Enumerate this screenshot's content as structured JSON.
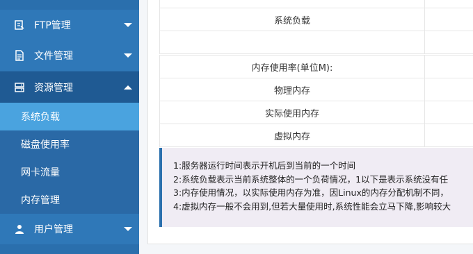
{
  "sidebar": {
    "menus": [
      {
        "label": "FTP管理",
        "icon": "ftp-icon"
      },
      {
        "label": "文件管理",
        "icon": "file-icon"
      },
      {
        "label": "资源管理",
        "icon": "server-icon"
      }
    ],
    "submenu": [
      {
        "label": "系统负载"
      },
      {
        "label": "磁盘使用率"
      },
      {
        "label": "网卡流量"
      },
      {
        "label": "内存管理"
      }
    ],
    "user_menu": {
      "label": "用户管理",
      "icon": "user-icon"
    }
  },
  "main": {
    "rows_top": [
      {
        "label": ""
      },
      {
        "label": "系统负载"
      },
      {
        "label": ""
      }
    ],
    "memory_header": "内存使用率(单位M):",
    "memory_rows": [
      {
        "label": "物理内存"
      },
      {
        "label": "实际使用内存"
      },
      {
        "label": "虚拟内存"
      }
    ],
    "notes": [
      "1:服务器运行时间表示开机后到当前的一个时间",
      "2:系统负载表示当前系统整体的一个负荷情况，1以下是表示系统没有任",
      "3:内存使用情况，以实际使用内存为准，因Linux的内存分配机制不同，",
      "4:虚拟内存一般不会用到,但若大量使用时,系统性能会立马下降,影响较大"
    ]
  },
  "colors": {
    "sidebar_bg": "#2f78b8",
    "active_bg": "#1f5a93",
    "selected_bg": "#4aa3df",
    "note_border": "#2a6fad"
  }
}
